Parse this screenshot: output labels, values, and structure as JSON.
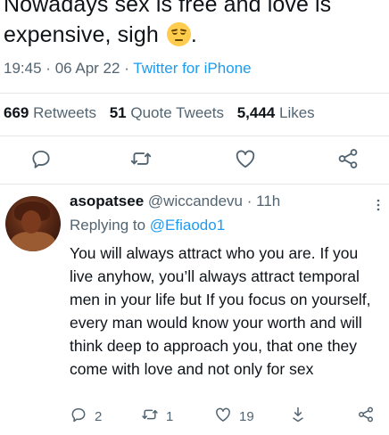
{
  "tweet": {
    "text": "Nowadays sex is free and love is expensive, sigh",
    "trailing": ".",
    "emoji": "pensive-face-emoji",
    "time": "19:45",
    "separator": "·",
    "date": "06 Apr 22",
    "source": "Twitter for iPhone"
  },
  "stats": {
    "retweets_count": "669",
    "retweets_label": "Retweets",
    "quotes_count": "51",
    "quotes_label": "Quote Tweets",
    "likes_count": "5,444",
    "likes_label": "Likes"
  },
  "actions": {
    "icons": [
      "reply-icon",
      "retweet-icon",
      "like-icon",
      "share-icon"
    ]
  },
  "reply": {
    "display_name": "asopatsee",
    "handle": "@wiccandevu",
    "separator": "·",
    "age": "11h",
    "replying_label": "Replying to",
    "replying_to": "@Efiaodo1",
    "text": "You will always attract who you are. If you live anyhow, you’ll always attract temporal men in your life but If you focus on yourself, every man would know your worth and will think deep to approach you, that one they come with love and not only for sex",
    "reply_count": "2",
    "retweet_count": "1",
    "like_count": "19"
  },
  "colors": {
    "accent": "#1d9bf0",
    "secondary_text": "#536471",
    "primary_text": "#0f1419",
    "divider": "#e3e7ea"
  }
}
